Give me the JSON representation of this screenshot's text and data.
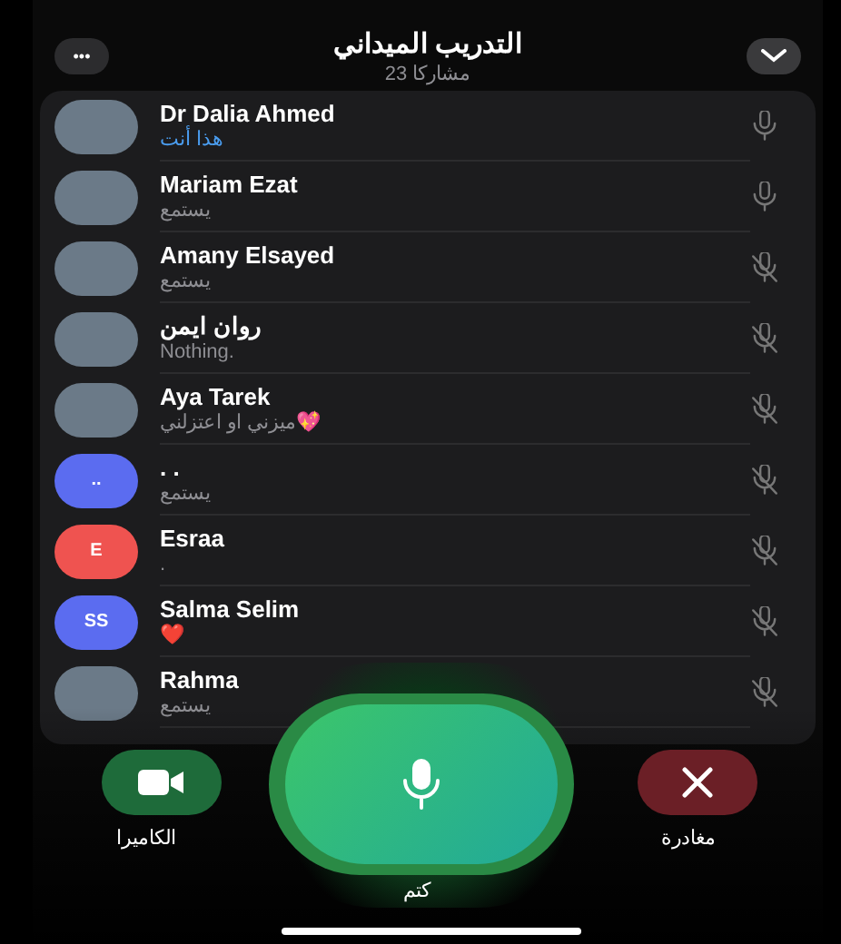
{
  "header": {
    "title": "التدريب الميداني",
    "subtitle": "23 مشاركا",
    "more_button": "•••"
  },
  "participants": [
    {
      "name": "Dr Dalia Ahmed",
      "status": "هذا أنت",
      "you": true,
      "muted": false,
      "avatar": {
        "kind": "photo"
      }
    },
    {
      "name": "Mariam Ezat",
      "status": "يستمع",
      "you": false,
      "muted": false,
      "avatar": {
        "kind": "photo"
      }
    },
    {
      "name": "Amany Elsayed",
      "status": "يستمع",
      "you": false,
      "muted": true,
      "avatar": {
        "kind": "photo"
      }
    },
    {
      "name": "روان ايمن",
      "status": "Nothing.",
      "you": false,
      "muted": true,
      "avatar": {
        "kind": "photo"
      }
    },
    {
      "name": "Aya Tarek",
      "status": "ميزني او اعتزلني💖",
      "you": false,
      "muted": true,
      "avatar": {
        "kind": "photo"
      }
    },
    {
      "name": ". .",
      "status": "يستمع",
      "you": false,
      "muted": true,
      "avatar": {
        "kind": "initials",
        "text": "..",
        "color": "#5b6cf0"
      }
    },
    {
      "name": "Esraa",
      "status": ".",
      "you": false,
      "muted": true,
      "avatar": {
        "kind": "initials",
        "text": "E",
        "color": "#ef5350"
      }
    },
    {
      "name": "Salma Selim",
      "status": "❤️",
      "you": false,
      "muted": true,
      "avatar": {
        "kind": "initials",
        "text": "SS",
        "color": "#5b6cf0"
      }
    },
    {
      "name": "Rahma",
      "status": "يستمع",
      "you": false,
      "muted": true,
      "avatar": {
        "kind": "photo"
      }
    }
  ],
  "controls": {
    "camera": "الكاميرا",
    "mute": "كتم",
    "leave": "مغادرة"
  }
}
